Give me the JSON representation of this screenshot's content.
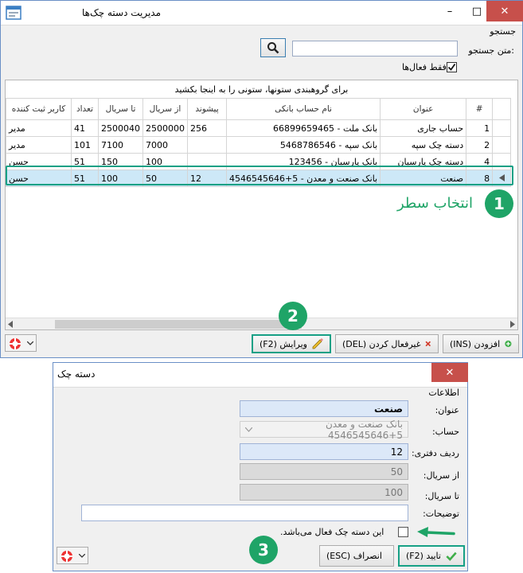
{
  "main_window": {
    "title": "مدیریت دسته چک‌ها",
    "controls": {
      "minimize": "–",
      "maximize": "□",
      "close": "✕"
    },
    "search_group_label": "جستجو",
    "search_label": "متن جستجو:",
    "search_value": "",
    "active_only_label": "فقط فعال‌ها",
    "active_only_checked": true,
    "group_hint": "برای گروهبندی ستونها، ستونی را به اینجا بکشید",
    "columns": [
      "#",
      "عنوان",
      "نام حساب بانکی",
      "پیشوند",
      "از سریال",
      "تا سریال",
      "تعداد",
      "کاربر ثبت کننده"
    ],
    "rows": [
      {
        "id": "1",
        "title": "حساب جاری",
        "account": "بانک ملت - 66899659465",
        "prefix": "256",
        "from": "2500000",
        "to": "2500040",
        "count": "41",
        "user": "مدیر"
      },
      {
        "id": "2",
        "title": "دسته چک سپه",
        "account": "بانک سپه - 5468786546",
        "prefix": "",
        "from": "7000",
        "to": "7100",
        "count": "101",
        "user": "مدیر"
      },
      {
        "id": "4",
        "title": "دسته چک پارسیان",
        "account": "بانک پارسیان - 123456",
        "prefix": "",
        "from": "100",
        "to": "150",
        "count": "51",
        "user": "حسن"
      },
      {
        "id": "8",
        "title": "صنعت",
        "account": "بانک صنعت و معدن - 5+4546545646",
        "prefix": "12",
        "from": "50",
        "to": "100",
        "count": "51",
        "user": "حسن"
      }
    ],
    "buttons": {
      "add": "(INS) افزودن",
      "deactivate": "(DEL) غیرفعال کردن",
      "edit": "(F2) ویرایش"
    },
    "annotations": {
      "step1_number": "1",
      "step1_text": "انتخاب سطر",
      "step2_number": "2"
    }
  },
  "dialog": {
    "title": "دسته چک",
    "close": "✕",
    "group_label": "اطلاعات",
    "labels": {
      "title": "عنوان:",
      "account": "حساب:",
      "row": "ردیف دفتری:",
      "from": "از سریال:",
      "to": "تا سریال:",
      "desc": "توضیحات:",
      "active": "این دسته چک فعال می‌باشد."
    },
    "values": {
      "title": "صنعت",
      "account": "بانک صنعت و معدن 5+4546545646",
      "row": "12",
      "from": "50",
      "to": "100",
      "desc": ""
    },
    "active_checked": false,
    "buttons": {
      "confirm": "(F2) تایید",
      "cancel": "(ESC) انصراف"
    },
    "annotations": {
      "step3_number": "3"
    }
  },
  "colors": {
    "accent_green": "#1fa467",
    "frame_green": "#16a085",
    "selected_row": "#cde8f7",
    "close_red": "#c7504b"
  }
}
